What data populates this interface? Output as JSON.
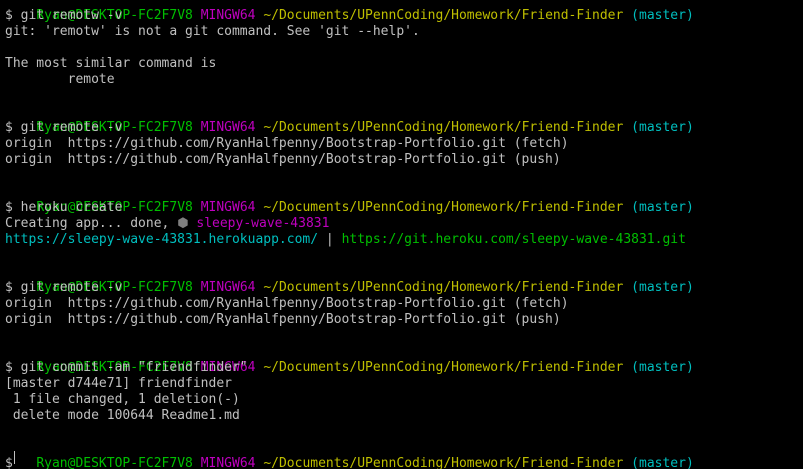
{
  "prompt": {
    "user_host": "Ryan@DESKTOP-FC2F7V8",
    "system": "MINGW64",
    "path": "~/Documents/UPennCoding/Homework/Friend-Finder",
    "branch": "(master)",
    "sign": "$"
  },
  "blocks": {
    "b1": {
      "command": "git remotw -v",
      "output": [
        "git: 'remotw' is not a git command. See 'git --help'.",
        "",
        "The most similar command is",
        "        remote"
      ]
    },
    "b2": {
      "command": "git remote -v",
      "output": [
        "origin  https://github.com/RyanHalfpenny/Bootstrap-Portfolio.git (fetch)",
        "origin  https://github.com/RyanHalfpenny/Bootstrap-Portfolio.git (push)"
      ]
    },
    "b3": {
      "command": "heroku create",
      "creating_prefix": "Creating app... done, ",
      "app_glyph": "⬢",
      "app_name": " sleepy-wave-43831",
      "web_url": "https://sleepy-wave-43831.herokuapp.com/",
      "separator": " | ",
      "git_url": "https://git.heroku.com/sleepy-wave-43831.git"
    },
    "b4": {
      "command": "git remote -v",
      "output": [
        "origin  https://github.com/RyanHalfpenny/Bootstrap-Portfolio.git (fetch)",
        "origin  https://github.com/RyanHalfpenny/Bootstrap-Portfolio.git (push)"
      ]
    },
    "b5": {
      "command": "git commit -am \"friendfinder\"",
      "output": [
        "[master d744e71] friendfinder",
        " 1 file changed, 1 deletion(-)",
        " delete mode 100644 Readme1.md"
      ]
    }
  },
  "colors": {
    "background": "#000000",
    "text": "#c0c0c0",
    "user_host": "#00bf00",
    "system": "#bf00bf",
    "path": "#bfbf00",
    "branch": "#00bfbf"
  }
}
